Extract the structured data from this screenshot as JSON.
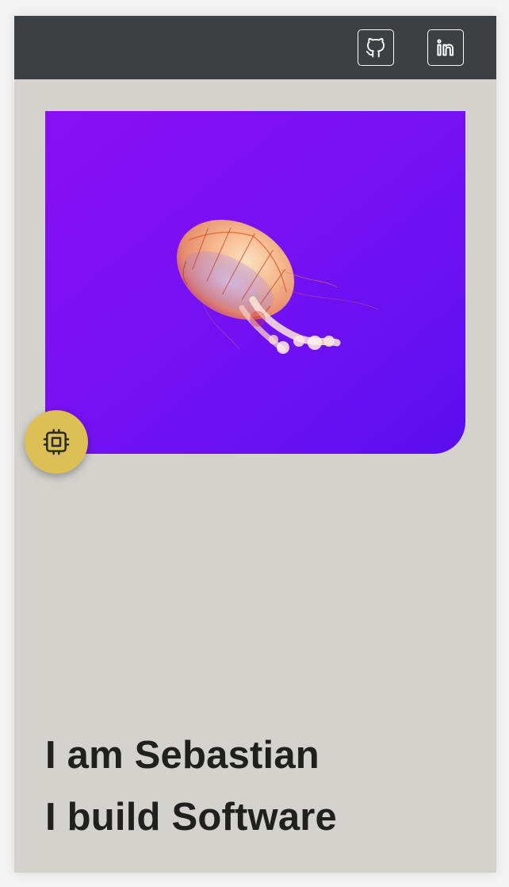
{
  "header": {
    "links": [
      {
        "icon": "github-icon",
        "color": "#ffffff"
      },
      {
        "icon": "linkedin-icon",
        "color": "#ffffff"
      }
    ],
    "background": "#3c4043"
  },
  "hero": {
    "image": "jellyfish-photo",
    "background_colors": [
      "#8a10f2",
      "#5a0ef0"
    ]
  },
  "fab": {
    "icon": "cpu-chip-icon",
    "color": "#dcbf55"
  },
  "intro": {
    "line1": "I am Sebastian",
    "line2": "I build Software"
  },
  "page": {
    "background": "#d4d2cd"
  }
}
